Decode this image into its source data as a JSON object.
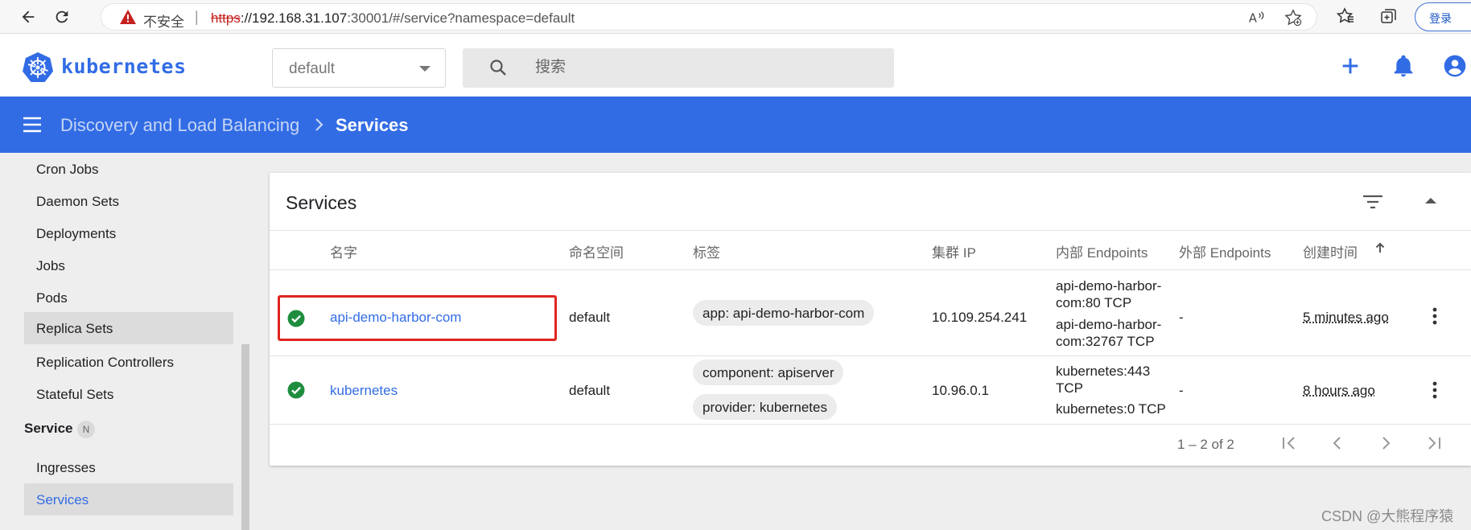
{
  "browser": {
    "security_label": "不安全",
    "separator": "|",
    "url_scheme": "https",
    "url_host": "://192.168.31.107",
    "url_rest": ":30001/#/service?namespace=default",
    "login_label": "登录"
  },
  "header": {
    "logo_text": "kubernetes",
    "namespace": "default",
    "search_placeholder": "搜索"
  },
  "breadcrumb": {
    "parent": "Discovery and Load Balancing",
    "current": "Services"
  },
  "sidebar": {
    "items_top": [
      {
        "label": "Cron Jobs"
      },
      {
        "label": "Daemon Sets"
      },
      {
        "label": "Deployments"
      },
      {
        "label": "Jobs"
      },
      {
        "label": "Pods"
      },
      {
        "label": "Replica Sets"
      },
      {
        "label": "Replication Controllers"
      },
      {
        "label": "Stateful Sets"
      }
    ],
    "section_label": "Service",
    "section_badge": "N",
    "items_service": [
      {
        "label": "Ingresses"
      },
      {
        "label": "Services"
      }
    ]
  },
  "card": {
    "title": "Services",
    "columns": [
      "名字",
      "命名空间",
      "标签",
      "集群 IP",
      "内部 Endpoints",
      "外部 Endpoints",
      "创建时间"
    ],
    "rows": [
      {
        "name": "api-demo-harbor-com",
        "namespace": "default",
        "labels": [
          "app: api-demo-harbor-com"
        ],
        "cluster_ip": "10.109.254.241",
        "internal_endpoints": [
          [
            "api-demo-harbor-",
            "com:80 TCP"
          ],
          [
            "api-demo-harbor-",
            "com:32767 TCP"
          ]
        ],
        "external_endpoints": "-",
        "created": "5 minutes ago"
      },
      {
        "name": "kubernetes",
        "namespace": "default",
        "labels": [
          "component: apiserver",
          "provider: kubernetes"
        ],
        "cluster_ip": "10.96.0.1",
        "internal_endpoints": [
          [
            "kubernetes:443",
            "TCP"
          ],
          [
            "kubernetes:0 TCP"
          ]
        ],
        "external_endpoints": "-",
        "created": "8 hours ago"
      }
    ],
    "pagination": "1 – 2 of 2"
  },
  "watermark": "CSDN @大熊程序猿",
  "colors": {
    "brand_blue": "#326ce5",
    "status_ok": "#1e8e3e",
    "highlight_red": "#e0241f"
  },
  "icons": [
    "back-icon",
    "reload-icon",
    "warning-icon",
    "read-aloud-icon",
    "favorite-add-icon",
    "favorites-icon",
    "collections-icon",
    "helm-logo-icon",
    "chevron-down-icon",
    "search-icon",
    "add-icon",
    "bell-icon",
    "account-icon",
    "menu-icon",
    "chevron-right-icon",
    "filter-icon",
    "collapse-icon",
    "check-circle-icon",
    "more-vert-icon",
    "first-page-icon",
    "prev-page-icon",
    "next-page-icon",
    "last-page-icon"
  ]
}
